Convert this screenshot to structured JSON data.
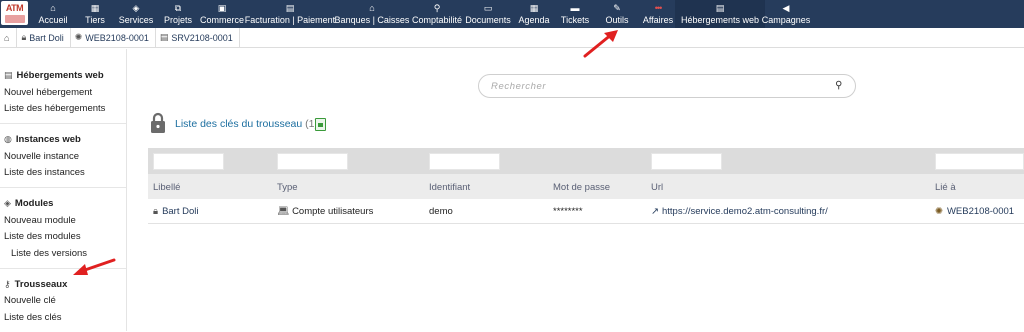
{
  "logo": {
    "text": "ATM"
  },
  "menu": [
    {
      "label": "Accueil",
      "icon": "home-icon"
    },
    {
      "label": "Tiers",
      "icon": "building-icon"
    },
    {
      "label": "Services",
      "icon": "cube-icon"
    },
    {
      "label": "Projets",
      "icon": "project-icon"
    },
    {
      "label": "Commerce",
      "icon": "briefcase-icon"
    },
    {
      "label": "Facturation | Paiement",
      "icon": "invoice-icon"
    },
    {
      "label": "Banques | Caisses",
      "icon": "bank-icon"
    },
    {
      "label": "Comptabilité",
      "icon": "search-dollar-icon"
    },
    {
      "label": "Documents",
      "icon": "folder-icon"
    },
    {
      "label": "Agenda",
      "icon": "calendar-icon"
    },
    {
      "label": "Tickets",
      "icon": "ticket-icon"
    },
    {
      "label": "Outils",
      "icon": "wrench-icon"
    },
    {
      "label": "Affaires",
      "icon": "dots-icon"
    },
    {
      "label": "Hébergements web",
      "icon": "server-icon"
    },
    {
      "label": "Campagnes",
      "icon": "megaphone-icon"
    }
  ],
  "breadcrumbs": [
    {
      "label": "Bart Doli",
      "icon": "lock-icon"
    },
    {
      "label": "WEB2108-0001",
      "icon": "web-instance-icon"
    },
    {
      "label": "SRV2108-0001",
      "icon": "server-icon"
    }
  ],
  "sidebar": {
    "sections": [
      {
        "title": "Hébergements web",
        "icon": "server-icon",
        "links": [
          "Nouvel hébergement",
          "Liste des hébergements"
        ]
      },
      {
        "title": "Instances web",
        "icon": "globe-icon",
        "links": [
          "Nouvelle instance",
          "Liste des instances"
        ]
      },
      {
        "title": "Modules",
        "icon": "cube-icon",
        "links": [
          "Nouveau module",
          "Liste des modules"
        ],
        "sublinks": [
          "Liste des versions"
        ]
      },
      {
        "title": "Trousseaux",
        "icon": "key-icon",
        "links": [
          "Nouvelle clé",
          "Liste des clés"
        ]
      }
    ]
  },
  "search": {
    "placeholder": "Rechercher"
  },
  "page": {
    "title": "Liste des clés du trousseau",
    "count": "(1)"
  },
  "table": {
    "headers": [
      "Libellé",
      "Type",
      "Identifiant",
      "Mot de passe",
      "Url",
      "Lié à"
    ],
    "rows": [
      {
        "label": "Bart Doli",
        "type": "Compte utilisateurs",
        "identifiant": "demo",
        "password": "********",
        "url": "https://service.demo2.atm-consulting.fr/",
        "linked": "WEB2108-0001"
      }
    ]
  },
  "colors": {
    "topbar": "#263c5c",
    "accent_link": "#1d6fa0",
    "annotation_arrow": "#e02020"
  }
}
